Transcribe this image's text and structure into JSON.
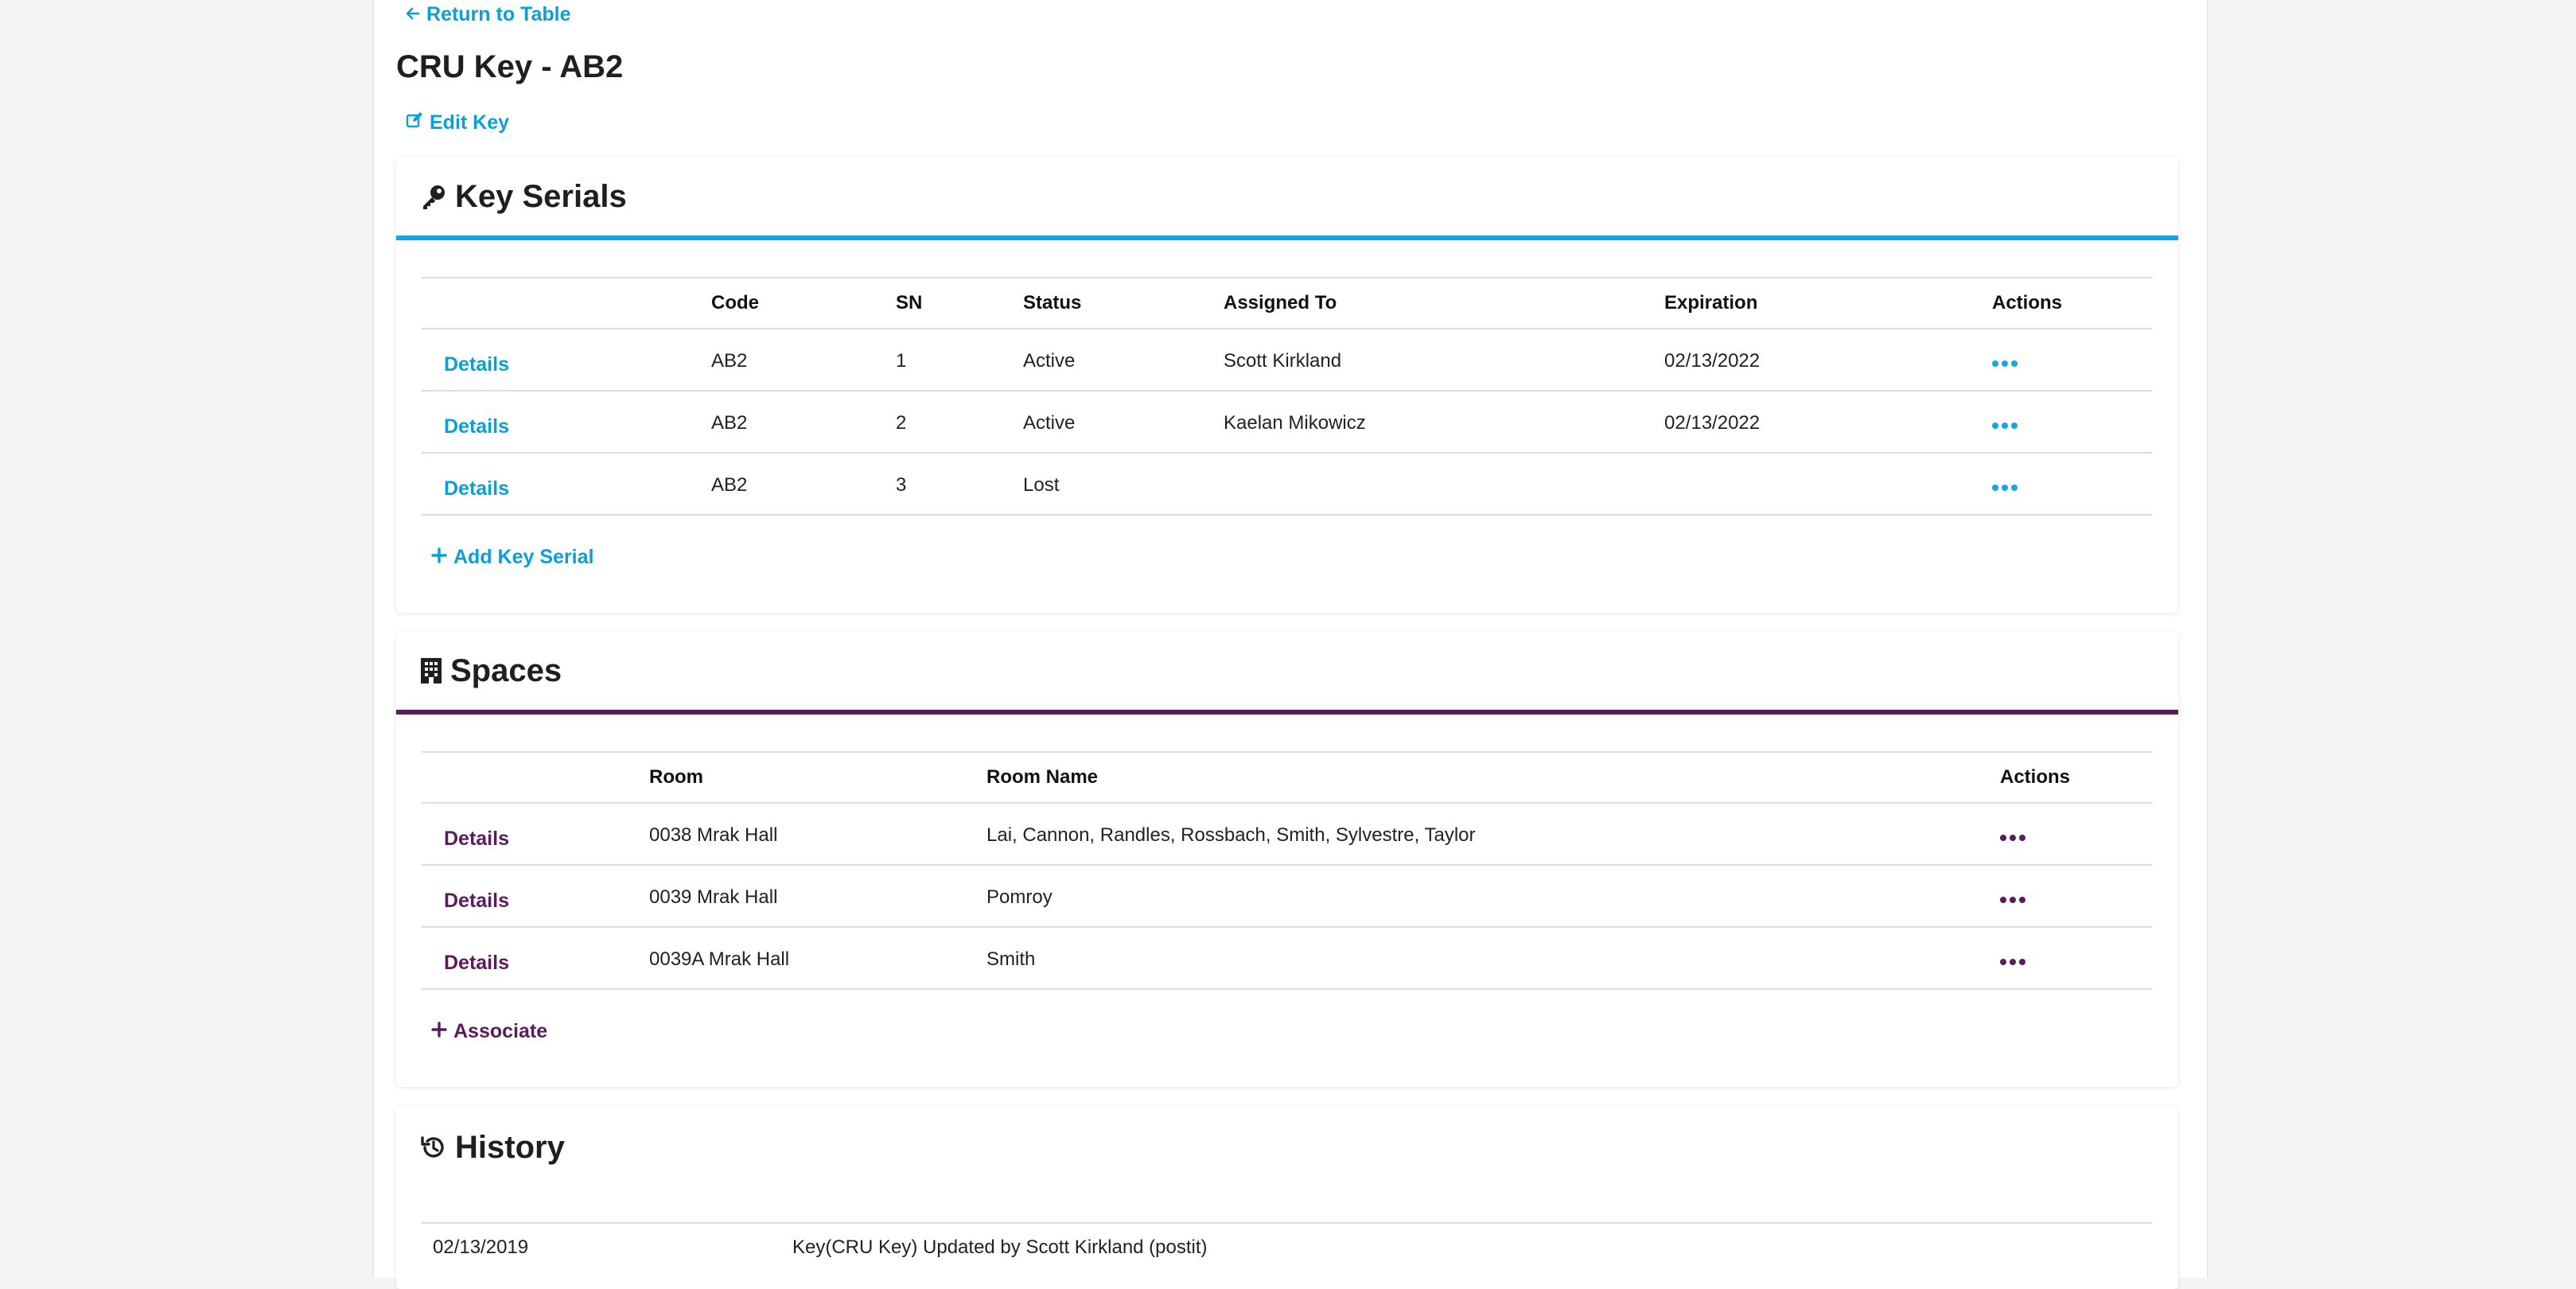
{
  "nav": {
    "return_label": "Return to Table"
  },
  "page": {
    "title": "CRU Key - AB2",
    "edit_label": "Edit Key"
  },
  "key_serials": {
    "title": "Key Serials",
    "columns": [
      "",
      "Code",
      "SN",
      "Status",
      "Assigned To",
      "Expiration",
      "Actions"
    ],
    "rows": [
      {
        "details": "Details",
        "code": "AB2",
        "sn": "1",
        "status": "Active",
        "assigned_to": "Scott Kirkland",
        "expiration": "02/13/2022"
      },
      {
        "details": "Details",
        "code": "AB2",
        "sn": "2",
        "status": "Active",
        "assigned_to": "Kaelan Mikowicz",
        "expiration": "02/13/2022"
      },
      {
        "details": "Details",
        "code": "AB2",
        "sn": "3",
        "status": "Lost",
        "assigned_to": "",
        "expiration": ""
      }
    ],
    "add_label": "Add Key Serial"
  },
  "spaces": {
    "title": "Spaces",
    "columns": [
      "",
      "Room",
      "Room Name",
      "Actions"
    ],
    "rows": [
      {
        "details": "Details",
        "room": "0038 Mrak Hall",
        "room_name": "Lai, Cannon, Randles, Rossbach, Smith, Sylvestre, Taylor"
      },
      {
        "details": "Details",
        "room": "0039 Mrak Hall",
        "room_name": "Pomroy"
      },
      {
        "details": "Details",
        "room": "0039A Mrak Hall",
        "room_name": "Smith"
      }
    ],
    "add_label": "Associate"
  },
  "history": {
    "title": "History",
    "rows": [
      {
        "date": "02/13/2019",
        "description": "Key(CRU Key) Updated by Scott Kirkland (postit)"
      }
    ]
  },
  "colors": {
    "accent_blue": "#11a9dd",
    "accent_purple": "#5c1b5c"
  },
  "icons": [
    "arrow-left-icon",
    "edit-icon",
    "key-icon",
    "building-icon",
    "history-icon",
    "plus-icon",
    "ellipsis-icon"
  ]
}
